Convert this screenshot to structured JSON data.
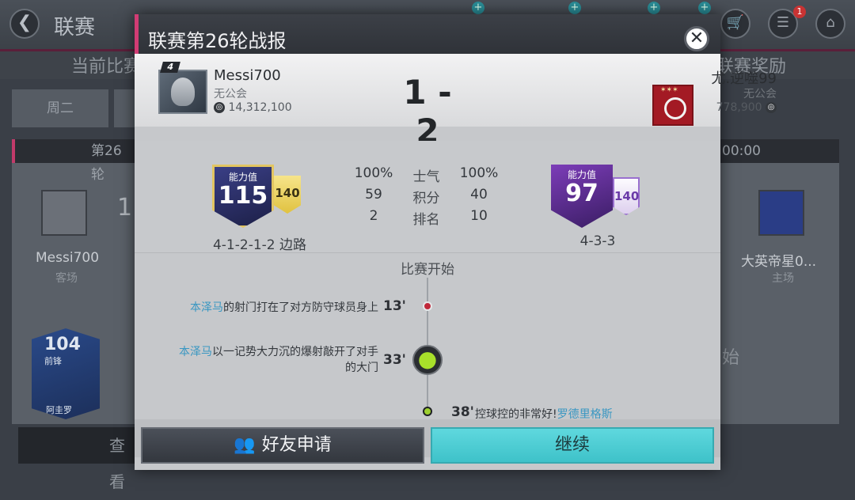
{
  "background": {
    "title": "联赛",
    "back_glyph": "❮",
    "subtab_left": "当前比赛",
    "subtab_right": "联赛奖励",
    "day_tab": "周二",
    "left_card_header": "第26轮",
    "right_card_header": "00:00",
    "left_player_name": "Messi700",
    "left_player_side": "客场",
    "right_player_name": "大英帝星0...",
    "right_player_side": "主场",
    "left_btn": "查看",
    "player_card_rating": "104",
    "player_card_pos": "前锋",
    "player_card_name": "阿圭罗",
    "notification_count": "1",
    "partial_text": "始",
    "partial_score": "1"
  },
  "modal": {
    "title": "联赛第26轮战报",
    "close_glyph": "✕"
  },
  "home": {
    "name": "Messi700",
    "club": "无公会",
    "coins": "14,312,100",
    "badge": "4",
    "rating_label": "能力值",
    "rating": "115",
    "sub_rating": "140",
    "formation": "4-1-2-1-2 边路"
  },
  "away": {
    "name": "尤.逆噬99",
    "club": "无公会",
    "coins": "778,900",
    "rating_label": "能力值",
    "rating": "97",
    "sub_rating": "140",
    "formation": "4-3-3"
  },
  "score": "1 - 2",
  "stats": [
    {
      "label": "士气",
      "home": "100%",
      "away": "100%"
    },
    {
      "label": "积分",
      "home": "59",
      "away": "40"
    },
    {
      "label": "排名",
      "home": "2",
      "away": "10"
    }
  ],
  "timeline": {
    "start_label": "比赛开始",
    "events": [
      {
        "player": "本泽马",
        "text": "的射门打在了对方防守球员身上",
        "minute": "13'"
      },
      {
        "player": "本泽马",
        "text": "以一记势大力沉的爆射敲开了对手",
        "text2": "的大门",
        "minute": "33'"
      },
      {
        "minute": "38'",
        "text": "控球控的非常好!",
        "player": "罗德里格斯"
      }
    ]
  },
  "buttons": {
    "friend_request": "好友申请",
    "continue": "继续"
  },
  "icons": {
    "coin_glyph": "◎",
    "ball_glyph": "●",
    "friend_glyph": "👥"
  }
}
